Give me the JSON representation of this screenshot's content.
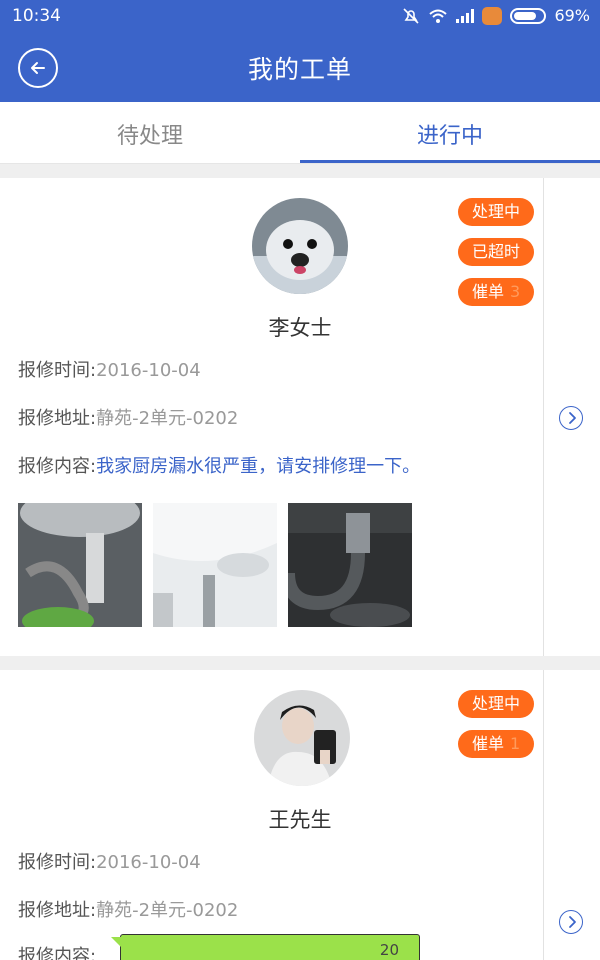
{
  "status_bar": {
    "time": "10:34",
    "battery": "69%"
  },
  "header": {
    "title": "我的工单"
  },
  "tabs": [
    {
      "label": "待处理"
    },
    {
      "label": "进行中"
    }
  ],
  "colors": {
    "primary": "#3b64c9",
    "badge": "#ff6a1a"
  },
  "field_labels": {
    "time": "报修时间:",
    "address": "报修地址:",
    "content": "报修内容:"
  },
  "orders": [
    {
      "name": "李女士",
      "badges": [
        {
          "label": "处理中"
        },
        {
          "label": "已超时"
        },
        {
          "label": "催单",
          "count": "3"
        }
      ],
      "time": "2016-10-04",
      "address": "静苑-2单元-0202",
      "content": "我家厨房漏水很严重，请安排修理一下。",
      "photos": [
        "pipe-photo",
        "ceiling-photo",
        "drain-photo"
      ]
    },
    {
      "name": "王先生",
      "badges": [
        {
          "label": "处理中"
        },
        {
          "label": "催单",
          "count": "1"
        }
      ],
      "time": "2016-10-04",
      "address": "静苑-2单元-0202",
      "content_bubble_text": "20"
    }
  ]
}
